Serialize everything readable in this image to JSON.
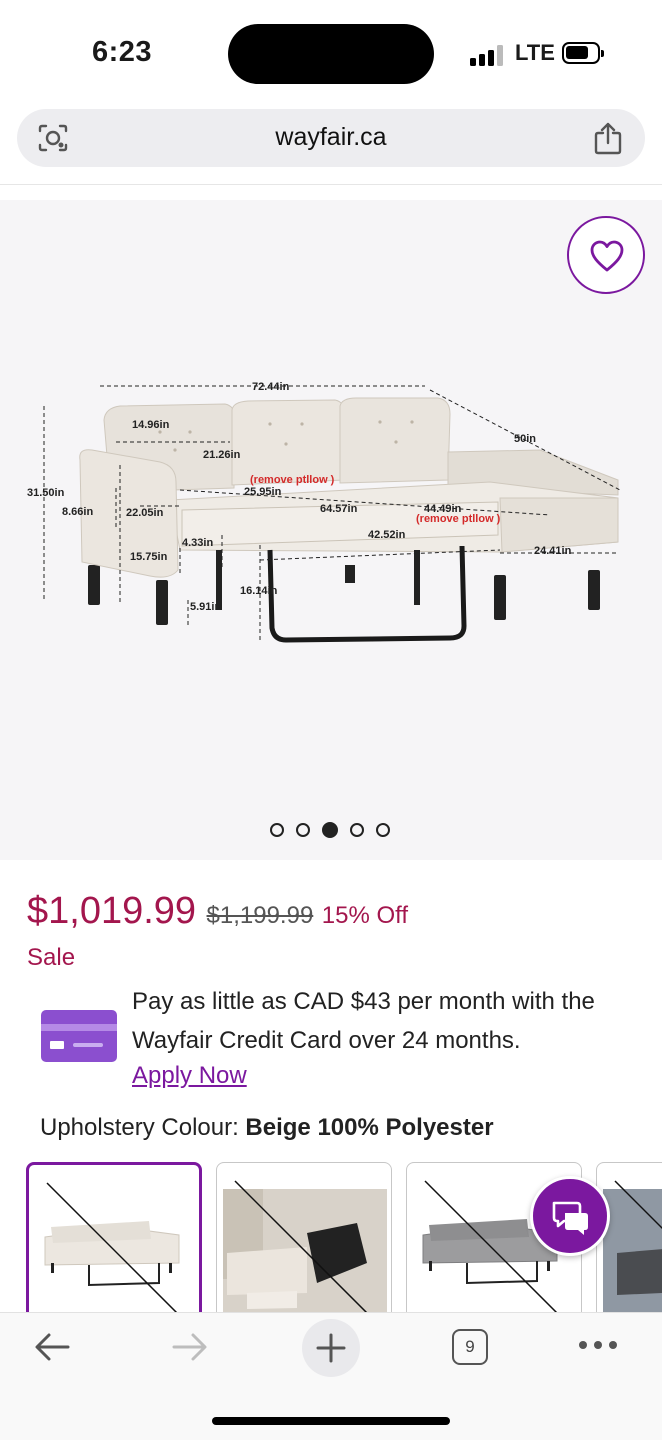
{
  "status_bar": {
    "time": "6:23",
    "network": "LTE"
  },
  "browser": {
    "url": "wayfair.ca",
    "tab_count": "9"
  },
  "product_image": {
    "carousel_total": 5,
    "carousel_active_index": 2,
    "dimension_labels": {
      "width": "72.44in",
      "depth": "50in",
      "height": "31.50in",
      "arm_width": "14.96in",
      "arm_depth": "21.26in",
      "remove_pillow_1": "(remove ptllow )",
      "back_depth": "25.95in",
      "seat_width": "64.57in",
      "chaise": "44.49in",
      "remove_pillow_2": "(remove ptllow )",
      "arm_height": "8.66in",
      "seat_h": "22.05in",
      "bed_width": "42.52in",
      "chaise_depth": "24.41in",
      "bed_thick": "4.33in",
      "leg_to_seat": "15.75in",
      "bed_height": "16.14in",
      "leg": "5.91in"
    }
  },
  "pricing": {
    "price": "$1,019.99",
    "original_price": "$1,199.99",
    "discount": "15% Off",
    "sale_label": "Sale"
  },
  "financing": {
    "text": "Pay as little as CAD $43 per month with the Wayfair Credit Card over 24 months.",
    "link": "Apply Now"
  },
  "option": {
    "label": "Upholstery Colour: ",
    "value": "Beige 100% Polyester"
  },
  "colors": {
    "brand_purple": "#7b189f",
    "price_red": "#a3164d"
  }
}
